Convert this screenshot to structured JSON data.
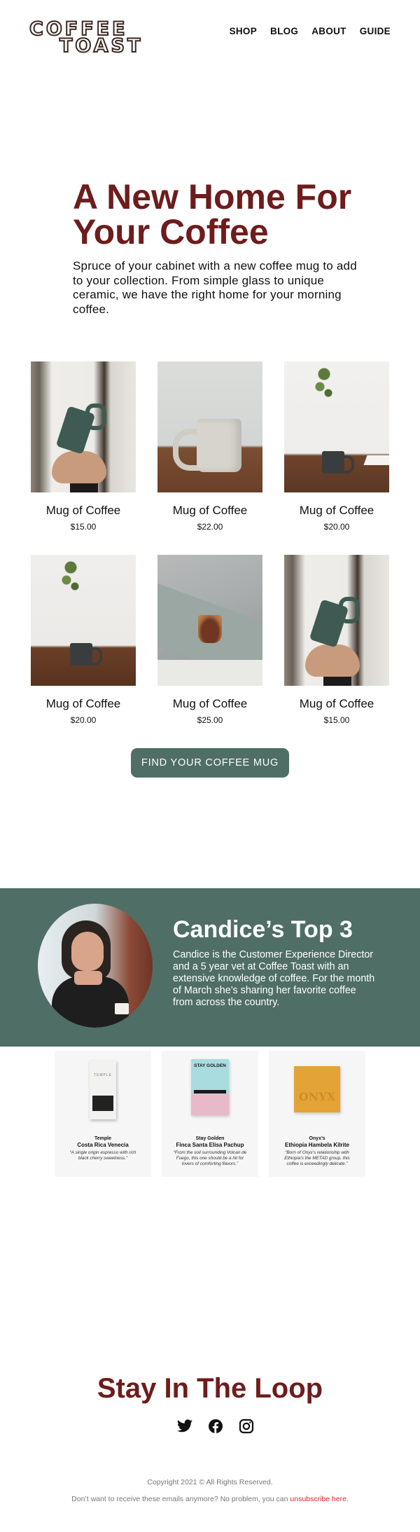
{
  "brand": {
    "line1": "COFFEE",
    "line2": "TOAST"
  },
  "nav": {
    "items": [
      "SHOP",
      "BLOG",
      "ABOUT",
      "GUIDE"
    ]
  },
  "hero": {
    "title": "A New Home For Your Coffee",
    "text": "Spruce of your cabinet with a new coffee mug to add to your collection. From simple glass to unique ceramic, we have the right home for your morning coffee."
  },
  "products": [
    {
      "name": "Mug of Coffee",
      "price": "$15.00"
    },
    {
      "name": "Mug of Coffee",
      "price": "$22.00"
    },
    {
      "name": "Mug of Coffee",
      "price": "$20.00"
    },
    {
      "name": "Mug of Coffee",
      "price": "$20.00"
    },
    {
      "name": "Mug of Coffee",
      "price": "$25.00"
    },
    {
      "name": "Mug of Coffee",
      "price": "$15.00"
    }
  ],
  "cta": {
    "label": "FIND YOUR COFFEE MUG"
  },
  "feature": {
    "title": "Candice’s Top 3",
    "text": "Candice is the Customer Experience Director and a 5 year vet at Coffee Toast with an extensive knowledge of coffee. For the month of March she’s sharing her favorite coffee from across the country."
  },
  "picks": [
    {
      "roaster": "Temple",
      "name": "Costa Rica Venecia",
      "quote": "“A single origin espresso with rich black cherry sweetness.”",
      "bag_text": "TEMPLE"
    },
    {
      "roaster": "Stay Golden",
      "name": "Finca Santa Elisa Pachup",
      "quote": "“From the soil surrounding Volcan de Fuego, this one should be a hit for lovers of comforting flavors.”",
      "bag_text": "STAY GOLDEN"
    },
    {
      "roaster": "Onyx’s",
      "name": "Ethiopia Hambela Kilrite",
      "quote": "“Born of Onyx’s relationship with Ethiopia’s the METAD group, this coffee is exceedingly delicate.”",
      "bag_text": "ONYX"
    }
  ],
  "loop": {
    "title": "Stay In The Loop"
  },
  "social": [
    "twitter-icon",
    "facebook-icon",
    "instagram-icon"
  ],
  "footer": {
    "copyright": "Copyright 2021 © All Rights Reserved.",
    "unsub_text": "Don’t want to receive these emails anymore? No problem, you can ",
    "unsub_link": "unsubscribe here."
  },
  "colors": {
    "brand_red": "#6e1c1c",
    "accent_green": "#4f6e66",
    "unsubscribe_red": "#d9262b"
  }
}
